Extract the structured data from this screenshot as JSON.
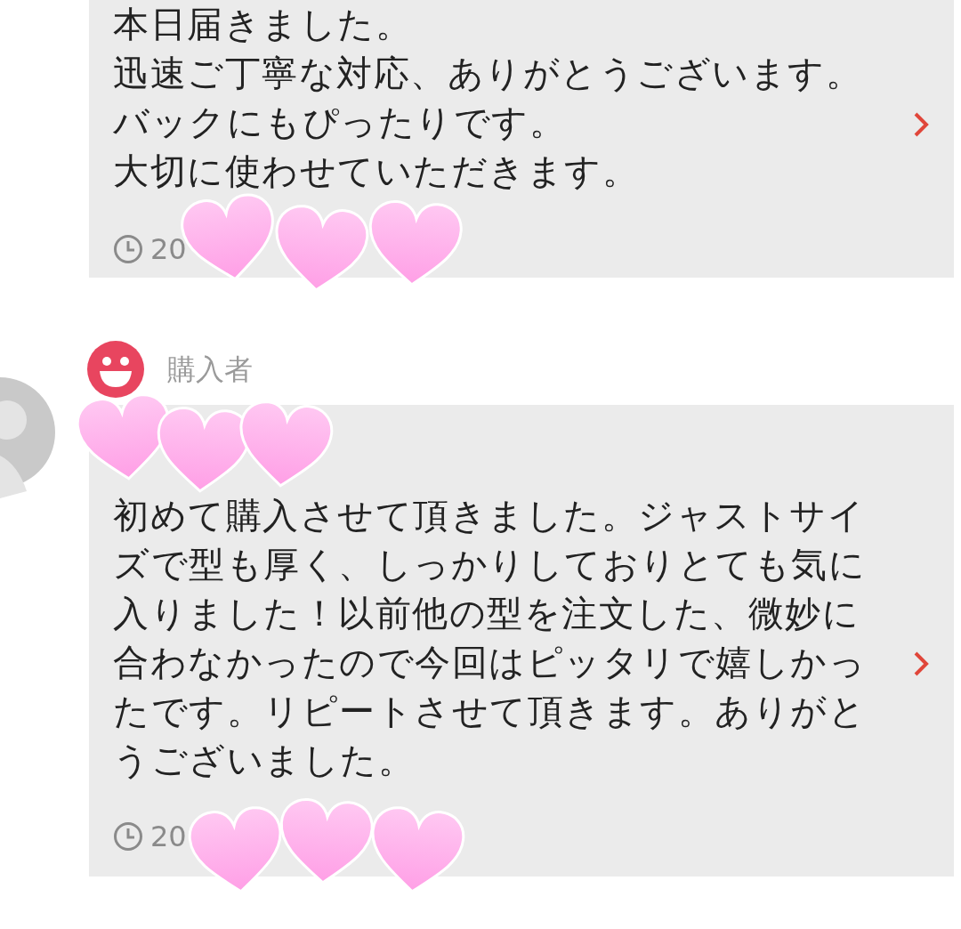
{
  "reviews": [
    {
      "lines": [
        "本日届きました。",
        "迅速ご丁寧な対応、ありがとうございます。",
        "バックにもぴったりです。",
        "大切に使わせていただきます。"
      ],
      "date": "20"
    },
    {
      "reviewer": {
        "name": "購入者"
      },
      "lines": [
        "初めて購入させて頂きました。ジャストサイ",
        "ズで型も厚く、しっかりしておりとても気に",
        "入りました！以前他の型を注文した、微妙に",
        "合わなかったので今回はピッタリで嬉しかっ",
        "たです。リピートさせて頂きます。ありがと",
        "うございました。"
      ],
      "date": "20"
    }
  ]
}
